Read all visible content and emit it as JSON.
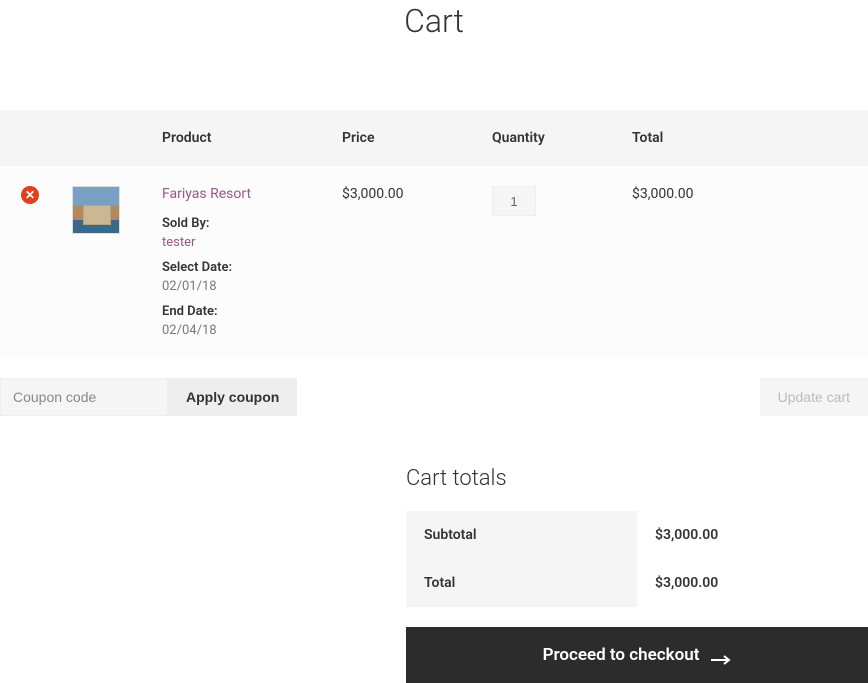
{
  "page": {
    "title": "Cart"
  },
  "headers": {
    "product": "Product",
    "price": "Price",
    "quantity": "Quantity",
    "total": "Total"
  },
  "items": [
    {
      "name": "Fariyas Resort",
      "sold_by_label": "Sold By:",
      "sold_by_value": "tester",
      "select_date_label": "Select Date:",
      "select_date_value": "02/01/18",
      "end_date_label": "End Date:",
      "end_date_value": "02/04/18",
      "price": "$3,000.00",
      "quantity": "1",
      "total": "$3,000.00"
    }
  ],
  "coupon": {
    "placeholder": "Coupon code",
    "apply_label": "Apply coupon"
  },
  "update_cart_label": "Update cart",
  "cart_totals": {
    "title": "Cart totals",
    "subtotal_label": "Subtotal",
    "subtotal_value": "$3,000.00",
    "total_label": "Total",
    "total_value": "$3,000.00"
  },
  "checkout_label": "Proceed to checkout"
}
